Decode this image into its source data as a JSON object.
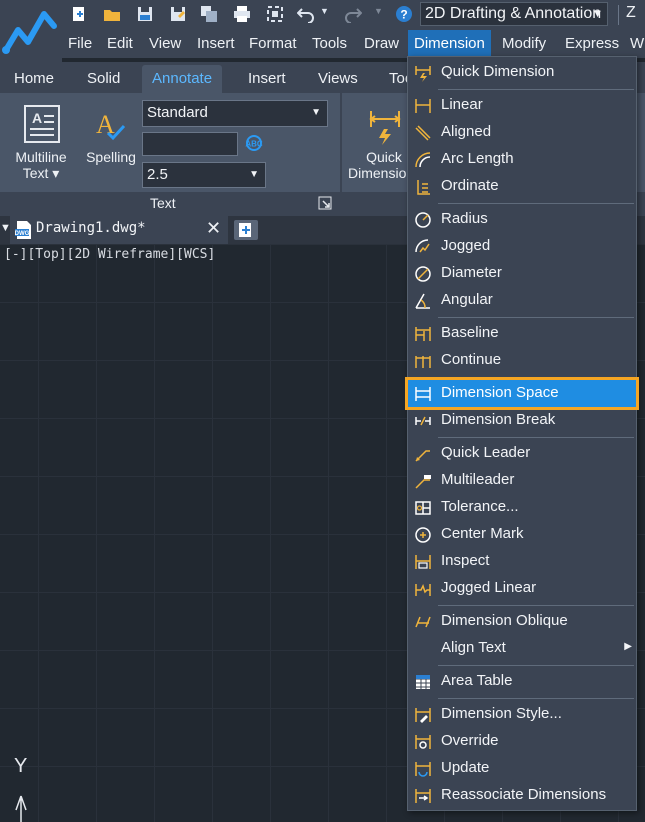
{
  "quick_access": {
    "icons": [
      "new-icon",
      "open-icon",
      "save-icon",
      "save-as-icon",
      "sheet-set-icon",
      "print-icon",
      "plot-icon",
      "undo-icon",
      "undo-dropdown-icon",
      "redo-icon",
      "redo-dropdown-icon",
      "help-icon"
    ],
    "workspace": "2D Drafting & Annotation",
    "cut_off_text": "Z"
  },
  "menubar": {
    "items": [
      "File",
      "Edit",
      "View",
      "Insert",
      "Format",
      "Tools",
      "Draw",
      "Dimension",
      "Modify",
      "Express",
      "W"
    ],
    "active": "Dimension"
  },
  "ribbon": {
    "tabs": [
      "Home",
      "Solid",
      "Annotate",
      "Insert",
      "Views",
      "Too"
    ],
    "active_tab": "Annotate",
    "multiline_text": "Multiline\nText ▾",
    "multiline_line1": "Multiline",
    "multiline_line2": "Text ▾",
    "spelling": "Spelling",
    "text_style": "Standard",
    "text_height": "2.5",
    "quick_dim_line1": "Quick",
    "quick_dim_line2": "Dimensio",
    "panel_title": "Text"
  },
  "document": {
    "tab_name": "Drawing1.dwg*",
    "viewport_label": "[-][Top][2D Wireframe][WCS]"
  },
  "ucs": {
    "y_label": "Y"
  },
  "dimension_menu": {
    "items": [
      {
        "label": "Quick Dimension",
        "icon": "quick-dimension-icon"
      },
      {
        "label": "Linear",
        "icon": "linear-icon"
      },
      {
        "label": "Aligned",
        "icon": "aligned-icon"
      },
      {
        "label": "Arc Length",
        "icon": "arc-length-icon"
      },
      {
        "label": "Ordinate",
        "icon": "ordinate-icon"
      },
      {
        "label": "Radius",
        "icon": "radius-icon"
      },
      {
        "label": "Jogged",
        "icon": "jogged-icon"
      },
      {
        "label": "Diameter",
        "icon": "diameter-icon"
      },
      {
        "label": "Angular",
        "icon": "angular-icon"
      },
      {
        "label": "Baseline",
        "icon": "baseline-icon"
      },
      {
        "label": "Continue",
        "icon": "continue-icon"
      },
      {
        "label": "Dimension Space",
        "icon": "dimension-space-icon",
        "highlighted": true
      },
      {
        "label": "Dimension Break",
        "icon": "dimension-break-icon"
      },
      {
        "label": "Quick Leader",
        "icon": "quick-leader-icon"
      },
      {
        "label": "Multileader",
        "icon": "multileader-icon"
      },
      {
        "label": "Tolerance...",
        "icon": "tolerance-icon"
      },
      {
        "label": "Center Mark",
        "icon": "center-mark-icon"
      },
      {
        "label": "Inspect",
        "icon": "inspect-icon"
      },
      {
        "label": "Jogged Linear",
        "icon": "jogged-linear-icon"
      },
      {
        "label": "Dimension Oblique",
        "icon": "dimension-oblique-icon"
      },
      {
        "label": "Align Text",
        "icon": "",
        "submenu": true
      },
      {
        "label": "Area Table",
        "icon": "area-table-icon"
      },
      {
        "label": "Dimension Style...",
        "icon": "dimension-style-icon"
      },
      {
        "label": "Override",
        "icon": "override-icon"
      },
      {
        "label": "Update",
        "icon": "update-icon"
      },
      {
        "label": "Reassociate Dimensions",
        "icon": "reassociate-icon"
      }
    ]
  },
  "colors": {
    "highlight": "#1f8de2",
    "highlight_outline": "#f5a623",
    "active_tab_text": "#5cb8ff",
    "menu_active": "#1f6fb8"
  }
}
